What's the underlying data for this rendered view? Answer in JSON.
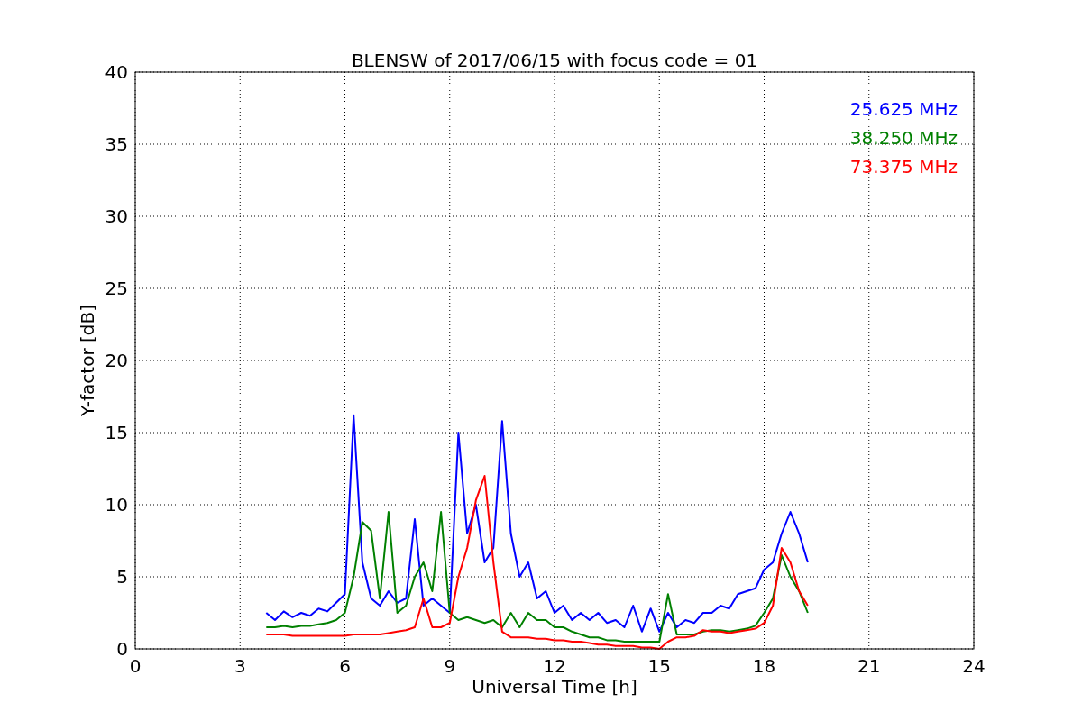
{
  "figure": {
    "chart_data": {
      "type": "line",
      "title": "BLENSW of 2017/06/15 with focus code = 01",
      "xlabel": "Universal Time [h]",
      "ylabel": "Y-factor [dB]",
      "x": [
        3.75,
        4.0,
        4.25,
        4.5,
        4.75,
        5.0,
        5.25,
        5.5,
        5.75,
        6.0,
        6.25,
        6.5,
        6.75,
        7.0,
        7.25,
        7.5,
        7.75,
        8.0,
        8.25,
        8.5,
        8.75,
        9.0,
        9.25,
        9.5,
        9.75,
        10.0,
        10.25,
        10.5,
        10.75,
        11.0,
        11.25,
        11.5,
        11.75,
        12.0,
        12.25,
        12.5,
        12.75,
        13.0,
        13.25,
        13.5,
        13.75,
        14.0,
        14.25,
        14.5,
        14.75,
        15.0,
        15.25,
        15.5,
        15.75,
        16.0,
        16.25,
        16.5,
        16.75,
        17.0,
        17.25,
        17.5,
        17.75,
        18.0,
        18.25,
        18.5,
        18.75,
        19.0,
        19.25
      ],
      "series": [
        {
          "name": "25.625 MHz",
          "color": "#0000ff",
          "values": [
            2.5,
            2.0,
            2.6,
            2.2,
            2.5,
            2.3,
            2.8,
            2.6,
            3.2,
            3.8,
            16.2,
            6.0,
            3.5,
            3.0,
            4.0,
            3.2,
            3.5,
            9.0,
            3.0,
            3.5,
            3.0,
            2.5,
            15.0,
            8.0,
            10.0,
            6.0,
            7.0,
            15.8,
            8.0,
            5.0,
            6.0,
            3.5,
            4.0,
            2.5,
            3.0,
            2.0,
            2.5,
            2.0,
            2.5,
            1.8,
            2.0,
            1.5,
            3.0,
            1.2,
            2.8,
            1.2,
            2.5,
            1.5,
            2.0,
            1.8,
            2.5,
            2.5,
            3.0,
            2.8,
            3.8,
            4.0,
            4.2,
            5.5,
            6.0,
            8.0,
            9.5,
            8.0,
            6.0
          ]
        },
        {
          "name": "38.250 MHz",
          "color": "#008000",
          "values": [
            1.5,
            1.5,
            1.6,
            1.5,
            1.6,
            1.6,
            1.7,
            1.8,
            2.0,
            2.5,
            5.0,
            8.8,
            8.2,
            3.5,
            9.5,
            2.5,
            3.0,
            5.0,
            6.0,
            4.0,
            9.5,
            2.5,
            2.0,
            2.2,
            2.0,
            1.8,
            2.0,
            1.5,
            2.5,
            1.5,
            2.5,
            2.0,
            2.0,
            1.5,
            1.5,
            1.2,
            1.0,
            0.8,
            0.8,
            0.6,
            0.6,
            0.5,
            0.5,
            0.5,
            0.5,
            0.5,
            3.8,
            1.0,
            1.0,
            1.0,
            1.2,
            1.3,
            1.3,
            1.2,
            1.3,
            1.4,
            1.6,
            2.5,
            3.5,
            6.5,
            5.0,
            4.0,
            2.5
          ]
        },
        {
          "name": "73.375 MHz",
          "color": "#ff0000",
          "values": [
            1.0,
            1.0,
            1.0,
            0.9,
            0.9,
            0.9,
            0.9,
            0.9,
            0.9,
            0.9,
            1.0,
            1.0,
            1.0,
            1.0,
            1.1,
            1.2,
            1.3,
            1.5,
            3.5,
            1.5,
            1.5,
            1.8,
            5.0,
            7.0,
            10.3,
            12.0,
            6.0,
            1.2,
            0.8,
            0.8,
            0.8,
            0.7,
            0.7,
            0.6,
            0.6,
            0.5,
            0.5,
            0.4,
            0.3,
            0.3,
            0.2,
            0.2,
            0.2,
            0.1,
            0.1,
            0.0,
            0.5,
            0.8,
            0.8,
            0.9,
            1.3,
            1.2,
            1.2,
            1.1,
            1.2,
            1.3,
            1.4,
            1.8,
            3.0,
            7.0,
            6.0,
            4.0,
            3.0
          ]
        }
      ],
      "grid": true,
      "xlim": [
        0,
        24
      ],
      "ylim": [
        0,
        40
      ],
      "xticks": [
        0,
        3,
        6,
        9,
        12,
        15,
        18,
        21,
        24
      ],
      "yticks": [
        0,
        5,
        10,
        15,
        20,
        25,
        30,
        35,
        40
      ]
    }
  }
}
